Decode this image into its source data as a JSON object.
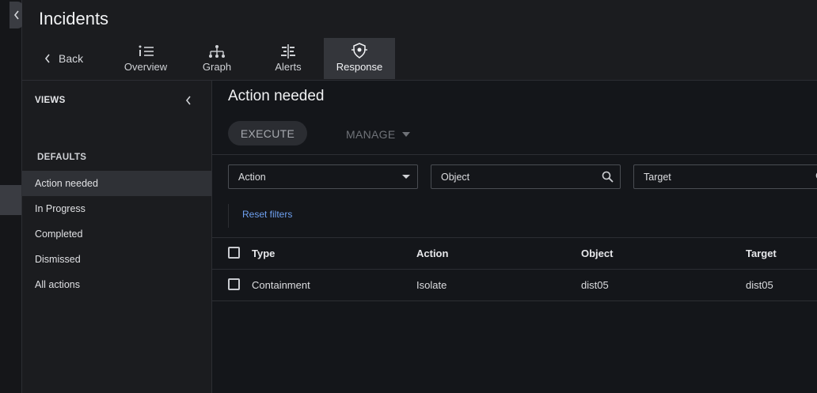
{
  "header": {
    "title": "Incidents",
    "back_label": "Back",
    "tabs": [
      {
        "label": "Overview",
        "icon": "list-icon"
      },
      {
        "label": "Graph",
        "icon": "graph-icon"
      },
      {
        "label": "Alerts",
        "icon": "alerts-icon"
      },
      {
        "label": "Response",
        "icon": "response-shield-icon",
        "active": true
      }
    ]
  },
  "sidebar": {
    "views_label": "VIEWS",
    "defaults_label": "DEFAULTS",
    "items": [
      {
        "label": "Action needed",
        "active": true
      },
      {
        "label": "In Progress"
      },
      {
        "label": "Completed"
      },
      {
        "label": "Dismissed"
      },
      {
        "label": "All actions"
      }
    ]
  },
  "main": {
    "title": "Action needed",
    "execute_label": "EXECUTE",
    "manage_label": "MANAGE",
    "filters": {
      "action": "Action",
      "object": "Object",
      "target": "Target"
    },
    "reset_label": "Reset filters",
    "table": {
      "headers": [
        "Type",
        "Action",
        "Object",
        "Target"
      ],
      "rows": [
        [
          "Containment",
          "Isolate",
          "dist05",
          "dist05"
        ]
      ]
    }
  },
  "colors": {
    "background": "#1b1c1f",
    "main_background": "#14161a",
    "active_tab": "#34363b",
    "link": "#6ea0f0"
  }
}
